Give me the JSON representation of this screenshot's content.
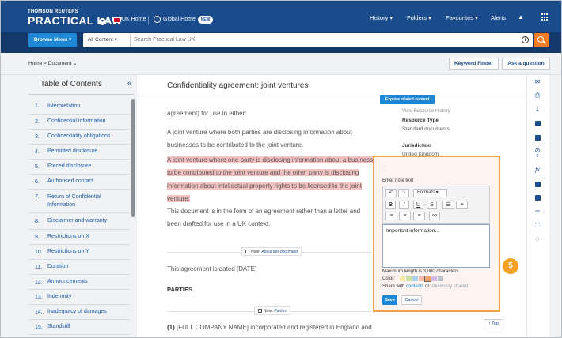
{
  "header": {
    "brand_small": "THOMSON REUTERS",
    "brand_big": "PRACTICAL LAW",
    "uk_home": "UK Home",
    "global_home": "Global Home",
    "new_badge": "NEW",
    "nav": {
      "history": "History ▾",
      "folders": "Folders ▾",
      "favourites": "Favourites ▾",
      "alerts": "Alerts"
    },
    "user_icon": "user-icon",
    "apps_icon": "apps-grid-icon"
  },
  "search": {
    "browse_menu": "Browse Menu ▾",
    "content_select": "All Content ▾",
    "placeholder": "Search Practical Law UK",
    "info_icon": "i"
  },
  "breadcrumb": {
    "text": "Home >  Document ⌄",
    "keyword_finder": "Keyword Finder",
    "ask_question": "Ask a question"
  },
  "toc": {
    "title": "Table of Contents",
    "collapse": "«",
    "items": [
      {
        "num": "1.",
        "label": "Interpretation"
      },
      {
        "num": "2.",
        "label": "Confidential information"
      },
      {
        "num": "3.",
        "label": "Confidentiality obligations"
      },
      {
        "num": "4.",
        "label": "Permitted disclosure"
      },
      {
        "num": "5.",
        "label": "Forced disclosure"
      },
      {
        "num": "6.",
        "label": "Authorised contact"
      },
      {
        "num": "7.",
        "label": "Return of Confidential Information"
      },
      {
        "num": "8.",
        "label": "Disclaimer and warranty"
      },
      {
        "num": "9.",
        "label": "Restrictions on X"
      },
      {
        "num": "10.",
        "label": "Restrictions on Y"
      },
      {
        "num": "11.",
        "label": "Duration"
      },
      {
        "num": "12.",
        "label": "Announcements"
      },
      {
        "num": "13.",
        "label": "Indemnity"
      },
      {
        "num": "14.",
        "label": "Inadequacy of damages"
      },
      {
        "num": "15.",
        "label": "Standstill"
      }
    ]
  },
  "document": {
    "title": "Confidentiality agreement: joint ventures",
    "explore_btn": "Explore related content",
    "para1": "agreement) for use in either:",
    "para2": "A joint venture where both parties are disclosing information about businesses to be contributed to the joint venture.",
    "para3_highlighted": "A joint venture where one party is disclosing information about a business to be contributed to the joint venture and the other party is disclosing information about intellectual property rights to be licensed to the joint venture.",
    "para4": "This document is in the form of an agreement rather than a letter and been drafted for use in a UK context.",
    "note1_label": "Note:",
    "note1_link": "About this document",
    "dated": "This agreement is dated [DATE]",
    "parties_heading": "PARTIES",
    "note2_label": "Note:",
    "note2_link": "Parties",
    "party1_start": "(1)",
    "party1": "[FULL COMPANY NAME] incorporated and registered in England and",
    "top_btn": "↑ Top"
  },
  "resource_sidebar": {
    "history_link": "View Resource History",
    "type_label": "Resource Type",
    "type_value": "Standard documents",
    "jurisdiction_label": "Jurisdiction",
    "jurisdiction_value": "United Kingdom"
  },
  "tools": [
    "envelope-icon",
    "print-icon",
    "download-icon",
    "folder-icon",
    "annotation-icon",
    "hide-annotations-icon",
    "formula-icon",
    "document-icon",
    "comment-icon",
    "link-icon",
    "fullscreen-icon",
    "bell-icon"
  ],
  "tool_badge": "0",
  "note_editor": {
    "dot": "·",
    "label": "Enter note text",
    "formats": "Formats ▾",
    "content": "Important information...",
    "max_length": "Maximum length is 3,000 characters",
    "color_label": "Color:",
    "colors": [
      "#f6e7a6",
      "#c9e3a2",
      "#a9d2f1",
      "#f3b9a6",
      "#f4a26b",
      "#d6b6e6",
      "#b8c1cc"
    ],
    "share_prefix": "Share with ",
    "share_contacts": "contacts",
    "share_or": " or ",
    "share_previous": "previously shared",
    "save": "Save",
    "cancel": "Cancel"
  },
  "step_badge": "5",
  "colors": {
    "nav_blue": "#1a4c8b",
    "accent_blue": "#1e88d6",
    "orange": "#f47b20",
    "highlight": "#f5c2c2",
    "editor_border": "#f0a548"
  }
}
